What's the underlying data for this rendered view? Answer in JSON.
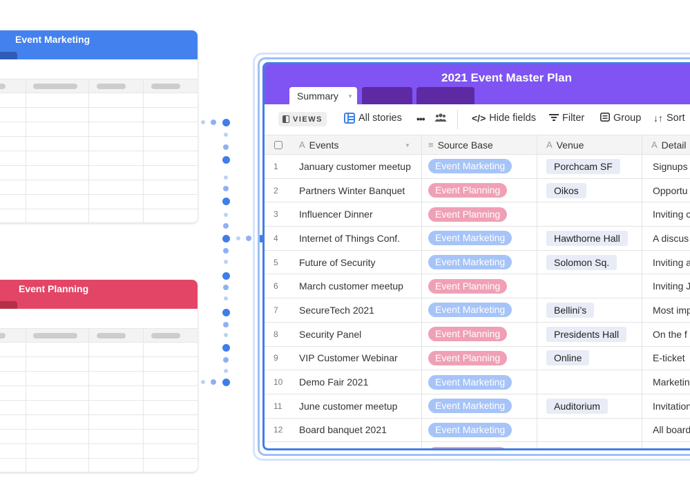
{
  "left_bases": [
    {
      "title": "Event Marketing",
      "color": "#4381ef"
    },
    {
      "title": "Event Planning",
      "color": "#e34566"
    }
  ],
  "main": {
    "title": "2021 Event Master Plan",
    "header_color": "#7f54f2",
    "tabs": [
      {
        "label": "Summary"
      },
      {
        "label": ""
      },
      {
        "label": ""
      }
    ],
    "toolbar": {
      "views_label": "VIEWS",
      "view_name": "All stories",
      "more_label": "•••",
      "hide_fields_label": "Hide fields",
      "filter_label": "Filter",
      "group_label": "Group",
      "sort_label": "Sort"
    },
    "columns": [
      {
        "label": "Events",
        "type_icon": "A"
      },
      {
        "label": "Source Base",
        "type_icon": "≡"
      },
      {
        "label": "Venue",
        "type_icon": "A"
      },
      {
        "label": "Detail",
        "type_icon": "A"
      }
    ],
    "rows": [
      {
        "num": "1",
        "event": "January customer meetup",
        "source": "Event Marketing",
        "venue": "Porchcam SF",
        "detail": "Signups"
      },
      {
        "num": "2",
        "event": "Partners Winter Banquet",
        "source": "Event Planning",
        "venue": "Oikos",
        "detail": "Opportu"
      },
      {
        "num": "3",
        "event": "Influencer Dinner",
        "source": "Event Planning",
        "venue": "",
        "detail": "Inviting c"
      },
      {
        "num": "4",
        "event": "Internet of Things Conf.",
        "source": "Event Marketing",
        "venue": "Hawthorne Hall",
        "detail": "A discus"
      },
      {
        "num": "5",
        "event": "Future of Security",
        "source": "Event Marketing",
        "venue": "Solomon Sq.",
        "detail": "Inviting a"
      },
      {
        "num": "6",
        "event": "March customer meetup",
        "source": "Event Planning",
        "venue": "",
        "detail": "Inviting J"
      },
      {
        "num": "7",
        "event": "SecureTech 2021",
        "source": "Event Marketing",
        "venue": "Bellini’s",
        "detail": "Most imp"
      },
      {
        "num": "8",
        "event": "Security Panel",
        "source": "Event Planning",
        "venue": "Presidents Hall",
        "detail": "On the f"
      },
      {
        "num": "9",
        "event": "VIP Customer Webinar",
        "source": "Event Planning",
        "venue": "Online",
        "detail": "E-ticket"
      },
      {
        "num": "10",
        "event": "Demo Fair 2021",
        "source": "Event Marketing",
        "venue": "",
        "detail": "Marketin"
      },
      {
        "num": "11",
        "event": "June customer meetup",
        "source": "Event Marketing",
        "venue": "Auditorium",
        "detail": "Invitation"
      },
      {
        "num": "12",
        "event": "Board banquet 2021",
        "source": "Event Marketing",
        "venue": "",
        "detail": "All board"
      },
      {
        "num": "",
        "event": "",
        "source": "Event Planning",
        "venue": "",
        "detail": ""
      }
    ],
    "source_colors": {
      "Event Marketing": "#a6c4f8",
      "Event Planning": "#f0a0b5"
    }
  }
}
